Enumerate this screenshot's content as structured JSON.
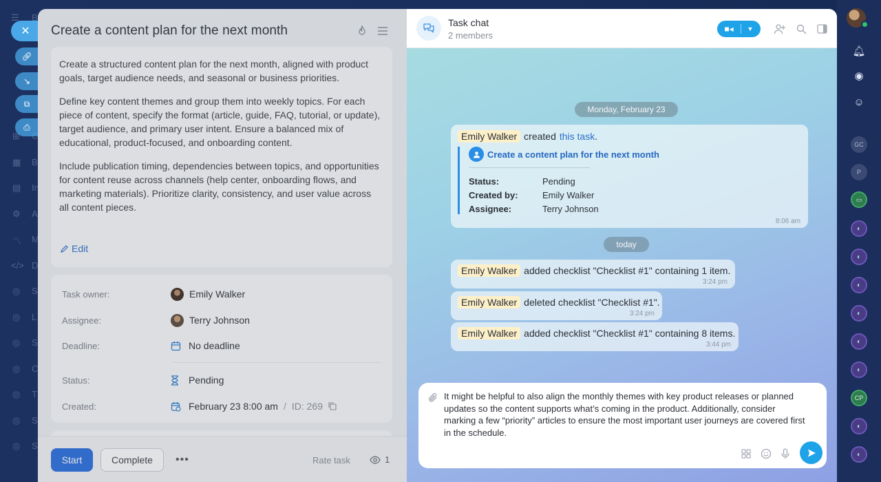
{
  "bg_nav": {
    "items": [
      "B",
      "C",
      "B",
      "In",
      "A",
      "M",
      "D",
      "S",
      "L",
      "S",
      "C",
      "T",
      "S",
      "S"
    ]
  },
  "task": {
    "title": "Create a content plan for the next month",
    "description": [
      "Create a structured content plan for the next month, aligned with product goals, target audience needs, and seasonal or business priorities.",
      "Define key content themes and group them into weekly topics. For each piece of content, specify the format (article, guide, FAQ, tutorial, or update), target audience, and primary user intent. Ensure a balanced mix of educational, product-focused, and onboarding content.",
      "Include publication timing, dependencies between topics, and opportunities for content reuse across channels (help center, onboarding flows, and marketing materials). Prioritize clarity, consistency, and user value across all content pieces."
    ],
    "edit_label": "Edit",
    "fields": {
      "owner_label": "Task owner:",
      "owner_value": "Emily Walker",
      "assignee_label": "Assignee:",
      "assignee_value": "Terry Johnson",
      "deadline_label": "Deadline:",
      "deadline_value": "No deadline",
      "status_label": "Status:",
      "status_value": "Pending",
      "created_label": "Created:",
      "created_value": "February 23 8:00 am",
      "id_sep": "/",
      "id_value": "ID: 269"
    },
    "footer": {
      "start_label": "Start",
      "complete_label": "Complete",
      "more_label": "•••",
      "rate_label": "Rate task",
      "views_count": "1"
    }
  },
  "chat": {
    "title": "Task chat",
    "subtitle": "2 members",
    "date_pill_1": "Monday, February 23",
    "date_pill_2": "today",
    "messages": {
      "created": {
        "author": "Emily Walker",
        "text": "created",
        "link": "this task",
        "link_suffix": ".",
        "quote_title": "Create a content plan for the next month",
        "status_label": "Status:",
        "status_value": "Pending",
        "created_by_label": "Created by:",
        "created_by_value": "Emily Walker",
        "assignee_label": "Assignee:",
        "assignee_value": "Terry Johnson",
        "time": "8:06 am"
      },
      "m1": {
        "author": "Emily Walker",
        "text": "added checklist \"Checklist #1\" containing 1 item.",
        "time": "3:24 pm"
      },
      "m2": {
        "author": "Emily Walker",
        "text": "deleted checklist \"Checklist #1\".",
        "time": "3:24 pm"
      },
      "m3": {
        "author": "Emily Walker",
        "text": "added checklist \"Checklist #1\" containing 8 items.",
        "time": "3:44 pm"
      }
    },
    "composer_text": "It might be helpful to also align the monthly themes with key product releases or planned updates so the content supports what’s coming in the product. Additionally, consider marking a few “priority” articles to ensure the most important user journeys are covered first in the schedule."
  },
  "rail": {
    "gc": "GC",
    "p": "P",
    "cp": "CP"
  },
  "colors": {
    "accent": "#2a6fe0",
    "chat_accent": "#1fa3e8",
    "name_highlight": "#fdf0c9"
  }
}
